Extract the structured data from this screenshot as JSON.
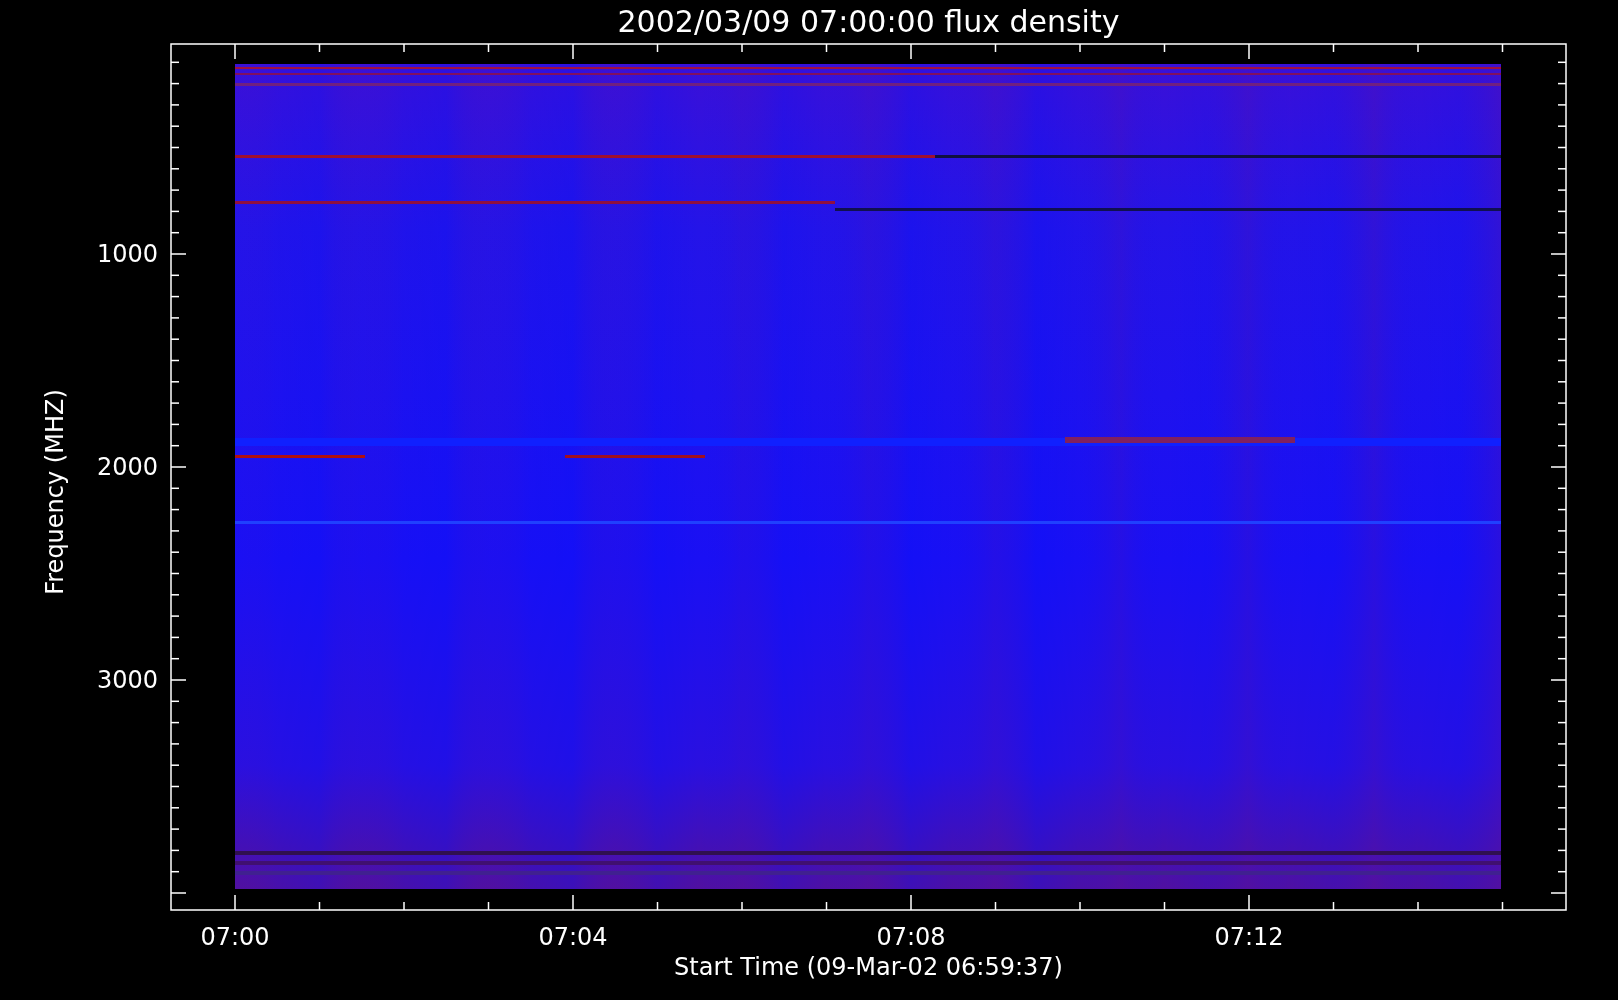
{
  "plot": {
    "title": "2002/03/09 07:00:00 flux density",
    "ylabel": "Frequency (MHZ)",
    "xlabel": "Start Time (09-Mar-02 06:59:37)",
    "xtick_labels": [
      "07:00",
      "07:04",
      "07:08",
      "07:12"
    ],
    "ytick_labels": [
      "1000",
      "2000",
      "3000"
    ]
  }
}
